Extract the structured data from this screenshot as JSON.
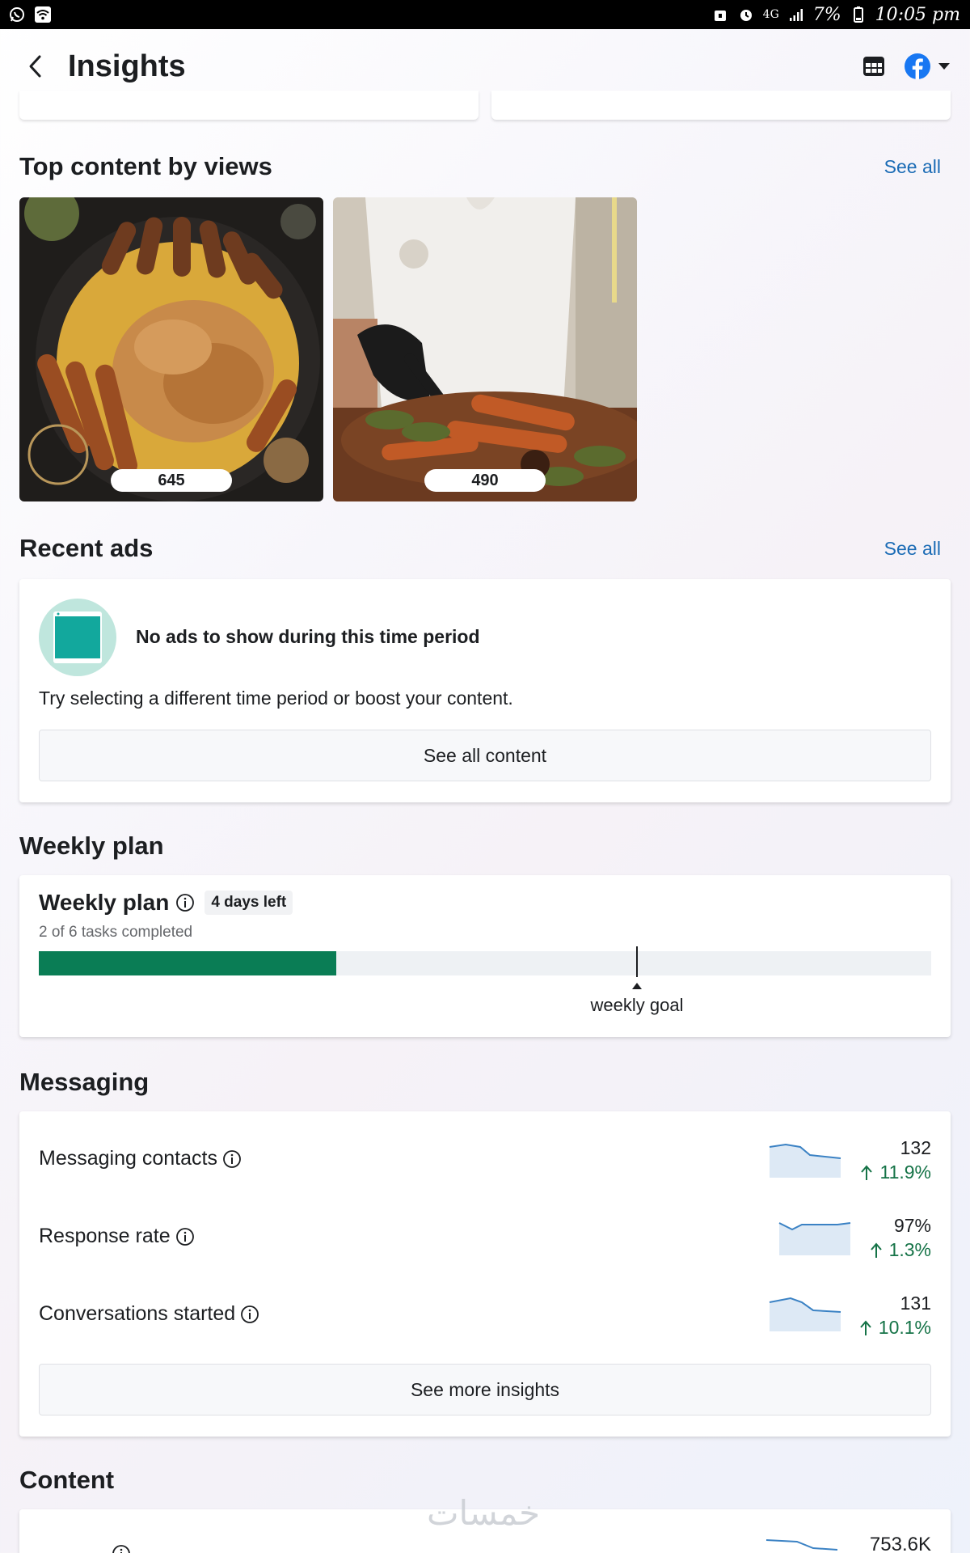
{
  "status_bar": {
    "network": "4G",
    "battery": "7%",
    "time": "10:05 pm"
  },
  "header": {
    "title": "Insights"
  },
  "top_content": {
    "title": "Top content by views",
    "see_all": "See all",
    "items": [
      {
        "views": "645"
      },
      {
        "views": "490"
      }
    ]
  },
  "recent_ads": {
    "title": "Recent ads",
    "see_all": "See all",
    "empty_title": "No ads to show during this time period",
    "empty_desc": "Try selecting a different time period or boost your content.",
    "button": "See all content"
  },
  "weekly_plan": {
    "section_title": "Weekly plan",
    "card_title": "Weekly plan",
    "days_left": "4 days left",
    "progress_text": "2 of 6 tasks completed",
    "completed": 2,
    "total": 6,
    "goal_label": "weekly goal",
    "goal_fraction": 0.67,
    "colors": {
      "progress": "#0a7d55",
      "track": "#eef1f4"
    }
  },
  "messaging": {
    "title": "Messaging",
    "metrics": [
      {
        "label": "Messaging contacts",
        "value": "132",
        "change": "11.9%"
      },
      {
        "label": "Response rate",
        "value": "97%",
        "change": "1.3%"
      },
      {
        "label": "Conversations started",
        "value": "131",
        "change": "10.1%"
      }
    ],
    "button": "See more insights"
  },
  "content": {
    "title": "Content",
    "first_metric_value": "753.6K"
  },
  "watermark": "خمسات",
  "icons": {
    "back": "chevron-left-icon",
    "table": "table-icon",
    "facebook": "facebook-icon",
    "dropdown": "caret-down-icon",
    "info": "info-icon",
    "up_arrow": "arrow-up-icon"
  }
}
